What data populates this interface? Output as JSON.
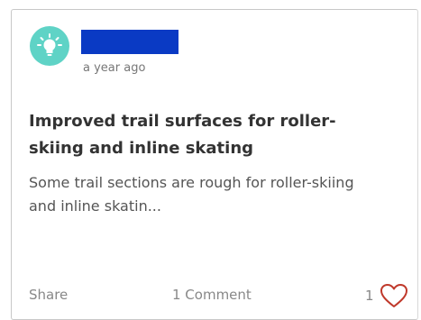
{
  "post": {
    "author_redacted": true,
    "timestamp": "a year ago",
    "title": "Improved trail surfaces for roller-skiing and inline skating",
    "excerpt": "Some trail sections are rough for roller-skiing and inline skatin...",
    "avatar_icon": "lightbulb-icon",
    "avatar_color": "#5fd3c6",
    "redaction_color": "#0a3ac4"
  },
  "footer": {
    "share_label": "Share",
    "comments_label": "1 Comment",
    "like_count": "1",
    "like_icon": "heart-outline-icon",
    "like_color": "#c0392b"
  }
}
